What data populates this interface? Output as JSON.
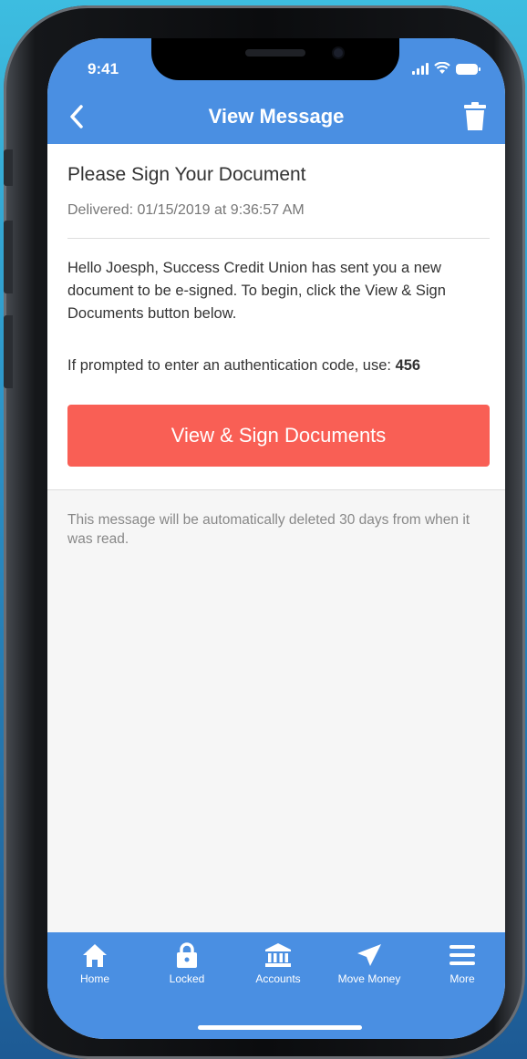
{
  "status_bar": {
    "time": "9:41"
  },
  "nav": {
    "title": "View Message"
  },
  "message": {
    "title": "Please Sign Your Document",
    "delivered": "Delivered: 01/15/2019 at 9:36:57 AM",
    "body": "Hello Joesph, Success Credit Union has sent you a new document to be e-signed. To begin, click the View & Sign Documents button below.",
    "auth_prefix": "If prompted to enter an authentication code, use: ",
    "auth_code": "456",
    "button_label": "View & Sign Documents"
  },
  "notice": "This message will be automatically deleted 30 days from when it was read.",
  "tab_bar": {
    "items": [
      {
        "label": "Home",
        "icon": "home-icon"
      },
      {
        "label": "Locked",
        "icon": "lock-icon"
      },
      {
        "label": "Accounts",
        "icon": "bank-icon"
      },
      {
        "label": "Move Money",
        "icon": "send-icon"
      },
      {
        "label": "More",
        "icon": "menu-icon"
      }
    ]
  },
  "colors": {
    "primary": "#4a8fe2",
    "action": "#f95f55",
    "background": "#f6f6f6"
  }
}
